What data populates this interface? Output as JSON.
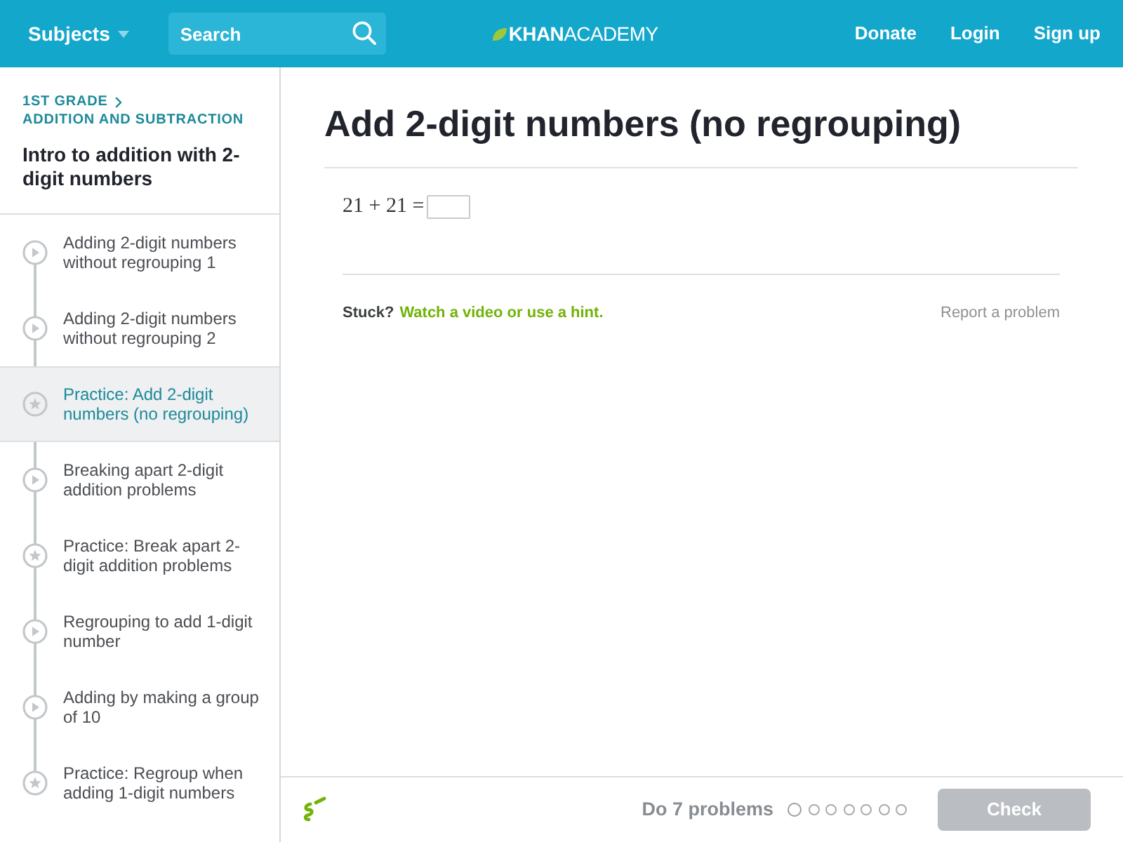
{
  "header": {
    "subjects": "Subjects",
    "search": {
      "placeholder": "Search"
    },
    "logo": "**KHAN**ACADEMY",
    "links": [
      "Donate",
      "Login",
      "Sign up"
    ]
  },
  "sidebar": {
    "breadcrumb": [
      "1ST GRADE",
      "ADDITION AND SUBTRACTION"
    ],
    "title": "Intro to addition with 2-digit numbers",
    "items": [
      {
        "kind": "video",
        "label": "Adding 2-digit numbers without regrouping 1",
        "selected": false
      },
      {
        "kind": "video",
        "label": "Adding 2-digit numbers without regrouping 2",
        "selected": false
      },
      {
        "kind": "practice",
        "label": "Practice: Add 2-digit numbers (no regrouping)",
        "selected": true
      },
      {
        "kind": "video",
        "label": "Breaking apart 2-digit addition problems",
        "selected": false
      },
      {
        "kind": "practice",
        "label": "Practice: Break apart 2-digit addition problems",
        "selected": false
      },
      {
        "kind": "video",
        "label": "Regrouping to add 1-digit number",
        "selected": false
      },
      {
        "kind": "video",
        "label": "Adding by making a group of 10",
        "selected": false
      },
      {
        "kind": "practice",
        "label": "Practice: Regroup when adding 1-digit numbers",
        "selected": false
      }
    ]
  },
  "exercise": {
    "title": "Add 2-digit numbers (no regrouping)",
    "problem": "21 + 21 =",
    "stuck": {
      "label": "Stuck?",
      "link": "Watch a video or use a hint."
    },
    "report_link": "Report a problem"
  },
  "footer": {
    "goal": "Do 7 problems",
    "progress": [
      {
        "current": true
      },
      {
        "current": false
      },
      {
        "current": false
      },
      {
        "current": false
      },
      {
        "current": false
      },
      {
        "current": false
      },
      {
        "current": false
      }
    ],
    "check_button": {
      "label": "Check",
      "disabled": true
    }
  }
}
